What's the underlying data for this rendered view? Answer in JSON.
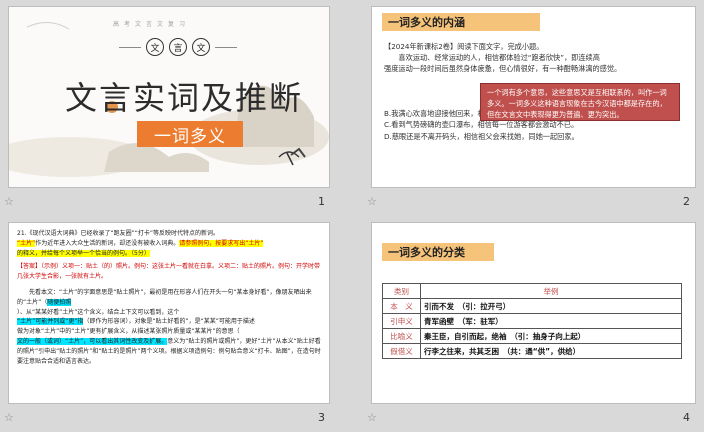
{
  "slide1": {
    "mini": "高考文言文复习",
    "circle_chars": [
      "文",
      "言",
      "文"
    ],
    "title": "文言实词及推断",
    "subtitle_box": "一词多义",
    "number": "1"
  },
  "slide2": {
    "header": "一词多义的内涵",
    "lines": [
      "【2024年新课标2卷】阅读下面文字，完成小题。",
      "　　喜欢运动、经常运动的人，相信都体验过“跑者欣快”，即连续高",
      "强度运动一段时间后虽然身体疲惫，但心情很好，有一种酣畅淋漓的感觉。",
      "",
      "",
      "B.我满心欢喜地迎接他回来，相信现在的他一定和从前不同。",
      "C.看到气势磅礴的壶口瀑布，相信每一位游客都会激动不已。",
      "D.慈眼还是不离开码头，相信祖父会来找她，同她一起回家。"
    ],
    "popup": "一个词有多个意思，这些意思又是互相联系的，叫作一词多义。一词多义这种语言现象在古今汉语中都是存在的，但在文言文中表现得更为普遍、更为突出。",
    "number": "2"
  },
  "slide3": {
    "line1": "21.《现代汉语大词典》已经收录了“跑友圈”“打卡”等反映时代特点的新词。",
    "line2a": "“土片”",
    "line2b": "作为近年进入大众生活的新词，却还没有被收入词典。",
    "line2c": "请参照例句，按要求写出“土片”",
    "line3": "的释义，并给每个义项举一个恰当的例句。（5分）",
    "answer": "【答案】（示例）义项一：贴土（的）照片。例句：这张土片一看就在白拿。义项二：贴土的照片。例句：开学时带几张大学生合影，一张就有土片。",
    "line4": "　　先看本文：“土片”的字面意思是“贴土照片”，最初是用在形容人们在开头一句“某本身好看”，像朋友晒出来的“土片”（",
    "line4b": "随便拍照",
    "line5": "）、从“某某好看”土片”这个含义，结合上下文可以看到，这个",
    "line6a": "“土片”可能并列或“更”指",
    "line6b": "（即作为形容词），对象是“贴土好看的”，是“某某”可能用于描述",
    "line7": "做为对象“土片”中的“土片”更有扩展含义，从描述某张照片质量或“某某片”的意思（",
    "line8": "文的一般（或词）“土片”，可以看出其词性改变及扩展。",
    "line8b": "意义为“贴土的照片或照片”，更好“土片”从本义“贴土好看的照片”引申出“贴土的照片”和“贴土的是照片”两个义项。根据义项造例句：例句贴合意义“打卡、贴图”，在造句时要注意贴合合适和语言表达。",
    "number": "3"
  },
  "slide4": {
    "header": "一词多义的分类",
    "col_headers": [
      "类别",
      "举例"
    ],
    "rows": [
      {
        "k": "本　义",
        "v": "引而不发　（引：拉开弓）"
      },
      {
        "k": "引申义",
        "v": "青军函壁　（军：驻军）"
      },
      {
        "k": "比喻义",
        "v": "秦王臣，自引而起，绝袖　（引：抽身子向上起）"
      },
      {
        "k": "假借义",
        "v": "行李之往来，共其乏困　（共：通“供”，供给）"
      }
    ],
    "number": "4"
  },
  "star": "☆"
}
